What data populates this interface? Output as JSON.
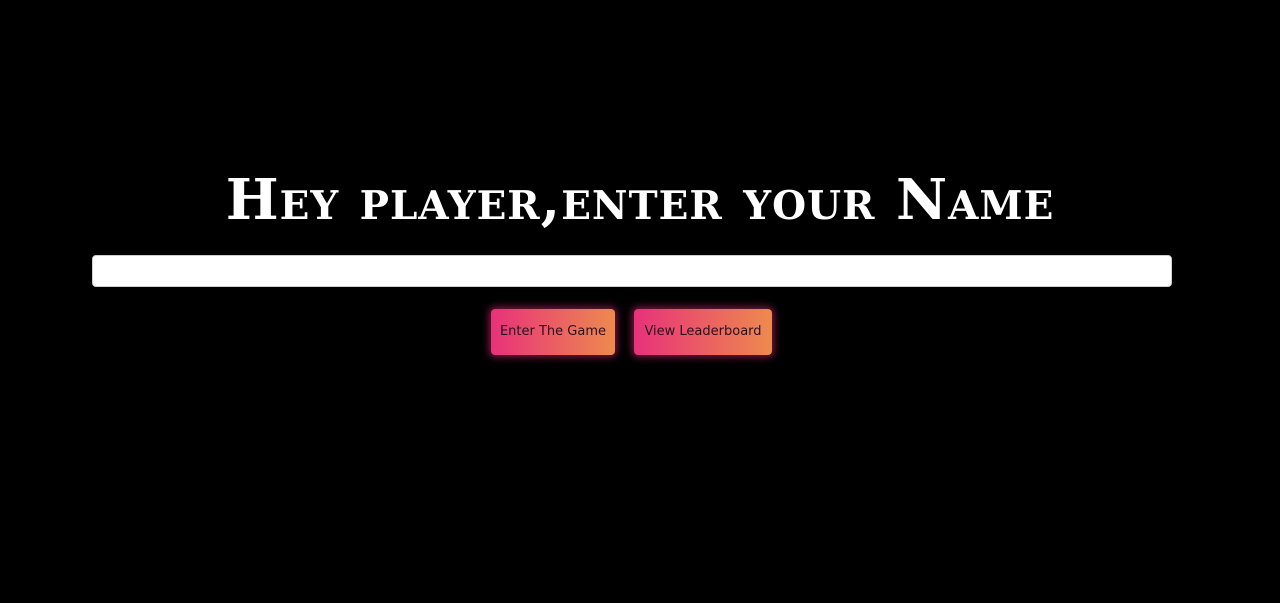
{
  "heading": {
    "text": "Hey player,enter your Name"
  },
  "name_input": {
    "value": "",
    "placeholder": ""
  },
  "buttons": {
    "enter_label": "Enter The Game",
    "leaderboard_label": "View Leaderboard"
  },
  "colors": {
    "background": "#000000",
    "heading": "#ffffff",
    "button_gradient_start": "#e8317a",
    "button_gradient_end": "#ee8a4e"
  }
}
